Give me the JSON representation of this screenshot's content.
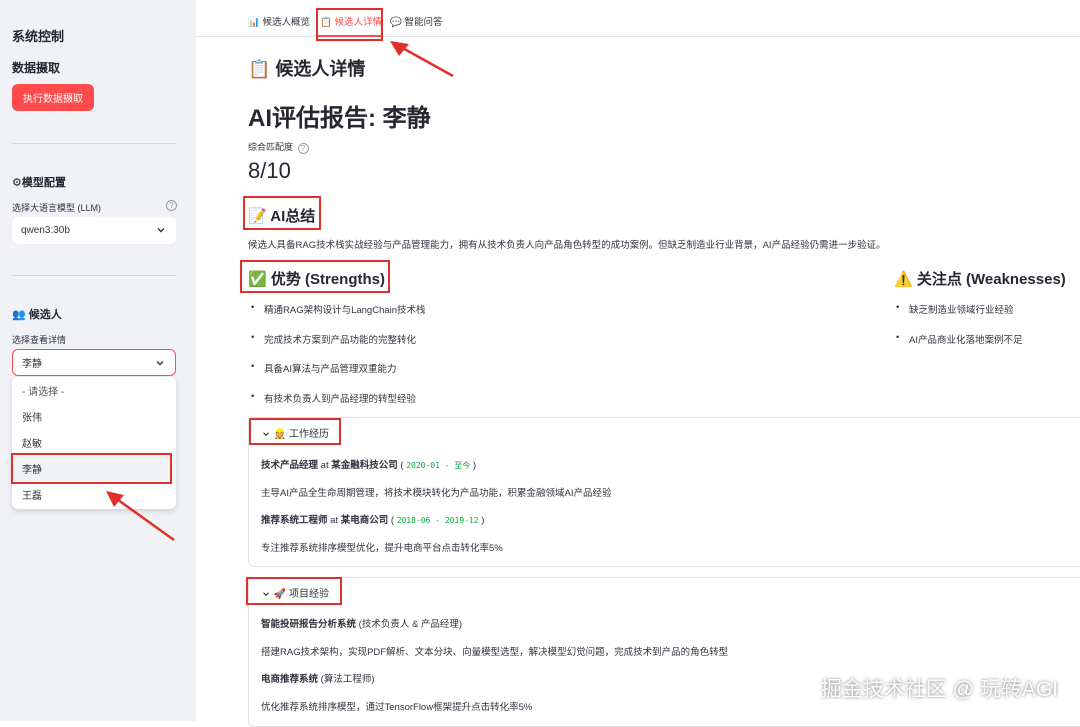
{
  "sidebar": {
    "title": "系统控制",
    "data_fetch_heading": "数据摄取",
    "fetch_button": "执行数据摄取",
    "model_heading": "⚙模型配置",
    "llm_label": "选择大语言模型 (LLM)",
    "llm_value": "qwen3:30b",
    "candidate_heading": "👥 候选人",
    "select_label": "选择查看详情",
    "select_value": "李静",
    "dropdown_options": [
      "- 请选择 -",
      "张伟",
      "赵敏",
      "李静",
      "王磊"
    ],
    "help_icon": "?"
  },
  "tabs": [
    {
      "label": "📊 候选人概览"
    },
    {
      "label": "📋 候选人详情"
    },
    {
      "label": "💬 智能问答"
    }
  ],
  "main": {
    "page_heading": "📋 候选人详情",
    "report_title": "AI评估报告: 李静",
    "metric_label": "综合匹配度",
    "metric_value": "8/10",
    "summary_heading": "📝 AI总结",
    "summary_text": "候选人具备RAG技术栈实战经验与产品管理能力，拥有从技术负责人向产品角色转型的成功案例。但缺乏制造业行业背景，AI产品经验仍需进一步验证。",
    "strengths_heading": "✅ 优势 (Strengths)",
    "strengths": [
      "精通RAG架构设计与LangChain技术栈",
      "完成技术方案到产品功能的完整转化",
      "具备AI算法与产品管理双重能力",
      "有技术负责人到产品经理的转型经验"
    ],
    "weaknesses_heading": "⚠️ 关注点 (Weaknesses)",
    "weaknesses": [
      "缺乏制造业领域行业经验",
      "AI产品商业化落地案例不足"
    ],
    "work_heading": "👷 工作经历",
    "work": [
      {
        "title": "技术产品经理",
        "at": "at",
        "company": "某金融科技公司",
        "period": "2020-01 - 至今",
        "desc": "主导AI产品全生命周期管理，将技术模块转化为产品功能，积累金融领域AI产品经验"
      },
      {
        "title": "推荐系统工程师",
        "at": "at",
        "company": "某电商公司",
        "period": "2018-06 - 2019-12",
        "desc": "专注推荐系统排序模型优化，提升电商平台点击转化率5%"
      }
    ],
    "project_heading": "🚀 项目经验",
    "projects": [
      {
        "name": "智能投研报告分析系统",
        "role": "(技术负责人 & 产品经理)",
        "desc": "搭建RAG技术架构，实现PDF解析、文本分块、向量模型选型，解决模型幻觉问题，完成技术到产品的角色转型"
      },
      {
        "name": "电商推荐系统",
        "role": "(算法工程师)",
        "desc": "优化推荐系统排序模型，通过TensorFlow框架提升点击转化率5%"
      }
    ]
  },
  "watermark": "掘金技术社区 @ 玩转AGI",
  "colors": {
    "accent": "#ff4b4b",
    "annotation": "#e0302b",
    "sidebar_bg": "#f0f2f6"
  }
}
